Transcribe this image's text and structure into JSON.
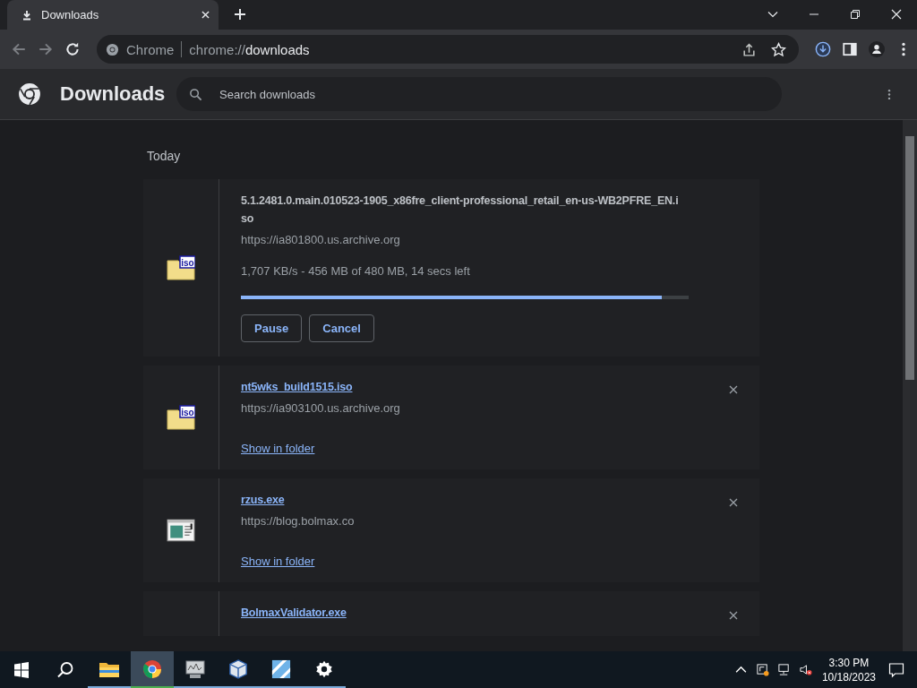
{
  "tabs": [
    {
      "title": "Downloads",
      "selected": true
    }
  ],
  "omnibox": {
    "site": "Chrome",
    "url": "chrome://**downloads**"
  },
  "header": {
    "title": "Downloads",
    "search": {
      "placeholder": "Search downloads"
    }
  },
  "section": "Today",
  "downloads": [
    {
      "kind": "in_progress",
      "file_icon": {
        "kind": "disc_image",
        "label": "iso"
      },
      "name": "5.1.2481.0.main.010523-1905_x86fre_client-professional_retail_en-us-WB2PFRE_EN.iso",
      "url": "https://ia801800.us.archive.org",
      "status": "1,707 KB/s - 456 MB of 480 MB, 14 secs left",
      "level": 0.94,
      "buttons": [
        "Pause",
        "Cancel"
      ]
    },
    {
      "kind": "complete",
      "file_icon": {
        "kind": "disc_image",
        "label": "iso"
      },
      "name": "nt5wks_build1515.iso",
      "url": "https://ia903100.us.archive.org",
      "link": "Show in folder"
    },
    {
      "kind": "complete",
      "file_icon": {
        "kind": "program"
      },
      "name": "rzus.exe",
      "url": "https://blog.bolmax.co",
      "link": "Show in folder"
    },
    {
      "kind": "complete",
      "name": "BolmaxValidator.exe"
    }
  ],
  "taskbar": {
    "apps": [
      {
        "kind": "folder",
        "selected": false
      },
      {
        "kind": "chrome",
        "selected": true
      },
      {
        "kind": "monitor",
        "selected": false
      },
      {
        "kind": "cube",
        "selected": false
      },
      {
        "kind": "tiles",
        "selected": false
      },
      {
        "kind": "gear",
        "selected": false
      }
    ],
    "time": "3:30 PM",
    "date": "10/18/2023"
  }
}
